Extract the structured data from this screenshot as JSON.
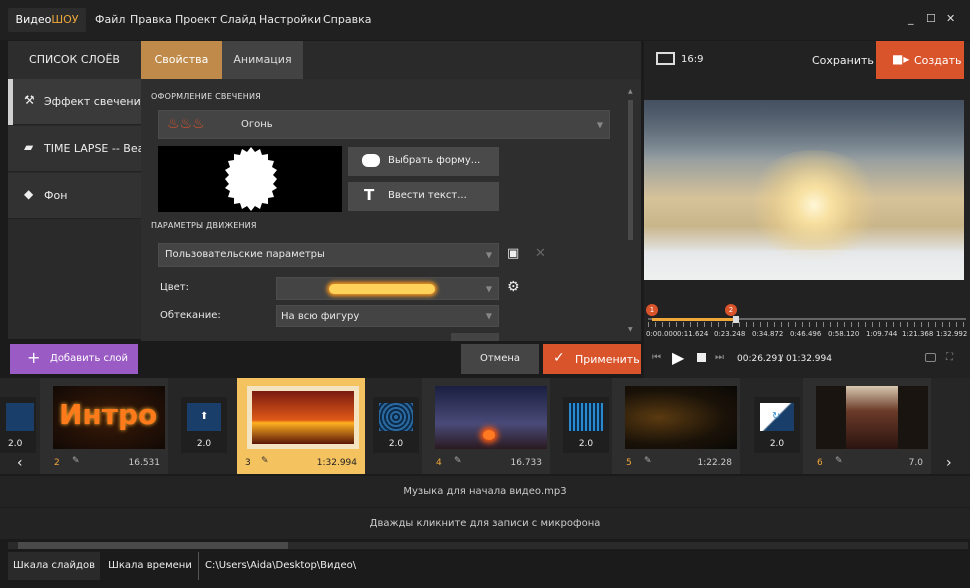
{
  "app": {
    "logo_a": "Видео",
    "logo_b": "ШОУ",
    "menu": [
      "Файл",
      "Правка",
      "Проект",
      "Слайд",
      "Настройки",
      "Справка"
    ],
    "window_controls": [
      "_",
      "☐",
      "✕"
    ]
  },
  "layers": {
    "header": "СПИСОК СЛОЁВ",
    "items": [
      {
        "label": "Эффект свечения",
        "icon": "magic-wand-icon"
      },
      {
        "label": "TIME LAPSE -- Bea...",
        "icon": "clapperboard-icon"
      },
      {
        "label": "Фон",
        "icon": "paint-bucket-icon"
      }
    ],
    "add_button": "Добавить слой"
  },
  "tabs": {
    "properties": "Свойства",
    "animation": "Анимация"
  },
  "glow": {
    "section_title": "ОФОРМЛЕНИЕ СВЕЧЕНИЯ",
    "preset_value": "Огонь",
    "choose_shape": "Выбрать форму...",
    "enter_text": "Ввести текст..."
  },
  "motion": {
    "section_title": "ПАРАМЕТРЫ ДВИЖЕНИЯ",
    "preset_value": "Пользовательские параметры",
    "color_label": "Цвет:",
    "wrap_label": "Обтекание:",
    "wrap_value": "На всю фигуру"
  },
  "actions": {
    "cancel": "Отмена",
    "apply": "Применить"
  },
  "preview": {
    "aspect": "16:9",
    "save": "Сохранить",
    "create": "Создать",
    "timeline_ticks": [
      "0:00.000",
      "0:11.624",
      "0:23.248",
      "0:34.872",
      "0:46.496",
      "0:58.120",
      "1:09.744",
      "1:21.368",
      "1:32.992"
    ],
    "markers": [
      "1",
      "2"
    ],
    "current_time": "00:26.291",
    "separator": "/",
    "total_time": "01:32.994"
  },
  "filmstrip": {
    "first_trans_duration": "2.0",
    "slides": [
      {
        "num": "2",
        "duration": "16.531",
        "thumb_text": "Интро"
      },
      {
        "num": "3",
        "duration": "1:32.994"
      },
      {
        "num": "4",
        "duration": "16.733"
      },
      {
        "num": "5",
        "duration": "1:22.28"
      },
      {
        "num": "6",
        "duration": "7.0"
      }
    ],
    "transitions": [
      "2.0",
      "2.0",
      "2.0",
      "2.0"
    ]
  },
  "tracks": {
    "music": "Музыка для начала видео.mp3",
    "mic": "Дважды кликните для записи с микрофона"
  },
  "status": {
    "slides_view": "Шкала слайдов",
    "timeline_view": "Шкала времени",
    "path": "C:\\Users\\Aida\\Desktop\\Видео\\"
  }
}
